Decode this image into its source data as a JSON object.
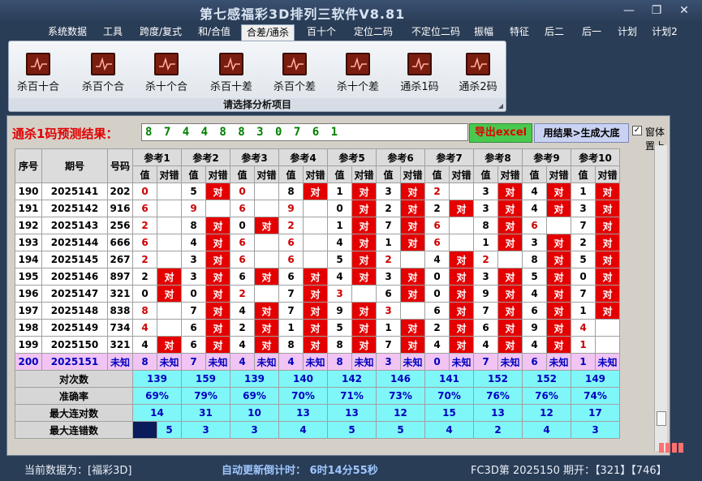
{
  "window": {
    "title": "第七感福彩3D排列三软件V8.81",
    "controls": {
      "minimize": "—",
      "restore": "❐",
      "close": "✕"
    }
  },
  "menu": [
    "系统数据",
    "工具",
    "跨度/复式",
    "和/合值",
    "合差/通杀",
    "百十个",
    "定位二码",
    "不定位二码",
    "振幅",
    "特征",
    "后二",
    "后一",
    "计划",
    "计划2"
  ],
  "menu_active": "合差/通杀",
  "ribbon": {
    "items": [
      "杀百十合",
      "杀百个合",
      "杀十个合",
      "杀百十差",
      "杀百个差",
      "杀十个差",
      "通杀1码",
      "通杀2码"
    ],
    "caption": "请选择分析项目",
    "icon": "chart-icon"
  },
  "prediction": {
    "label": "通杀1码预测结果：",
    "value": "8 7 4 4 8 8 3 0 7 6 1",
    "export_label": "导出excel",
    "generate_label": "用结果>生成大底",
    "pin_label": "窗体置上",
    "pin_checked": "✓"
  },
  "table": {
    "headers": {
      "seq": "序号",
      "period": "期号",
      "code": "号码",
      "refs": [
        "参考1",
        "参考2",
        "参考3",
        "参考4",
        "参考5",
        "参考6",
        "参考7",
        "参考8",
        "参考9",
        "参考10"
      ],
      "val": "值",
      "result": "对错"
    },
    "rows": [
      {
        "seq": "190",
        "period": "2025141",
        "code": "202",
        "cells": [
          [
            "0",
            "",
            "red"
          ],
          [
            "5",
            "对",
            ""
          ],
          [
            "0",
            "",
            "red"
          ],
          [
            "8",
            "对",
            ""
          ],
          [
            "1",
            "对",
            ""
          ],
          [
            "3",
            "对",
            ""
          ],
          [
            "2",
            "",
            "red"
          ],
          [
            "3",
            "对",
            ""
          ],
          [
            "4",
            "对",
            ""
          ],
          [
            "1",
            "对",
            ""
          ]
        ]
      },
      {
        "seq": "191",
        "period": "2025142",
        "code": "916",
        "cells": [
          [
            "6",
            "",
            "red"
          ],
          [
            "9",
            "",
            "red"
          ],
          [
            "6",
            "",
            "red"
          ],
          [
            "9",
            "",
            "red"
          ],
          [
            "0",
            "对",
            ""
          ],
          [
            "2",
            "对",
            ""
          ],
          [
            "2",
            "对",
            ""
          ],
          [
            "3",
            "对",
            ""
          ],
          [
            "4",
            "对",
            ""
          ],
          [
            "3",
            "对",
            ""
          ]
        ]
      },
      {
        "seq": "192",
        "period": "2025143",
        "code": "256",
        "cells": [
          [
            "2",
            "",
            "red"
          ],
          [
            "8",
            "对",
            ""
          ],
          [
            "0",
            "对",
            ""
          ],
          [
            "2",
            "",
            "red"
          ],
          [
            "1",
            "对",
            ""
          ],
          [
            "7",
            "对",
            ""
          ],
          [
            "6",
            "",
            "red"
          ],
          [
            "8",
            "对",
            ""
          ],
          [
            "6",
            "",
            "red"
          ],
          [
            "7",
            "对",
            ""
          ]
        ]
      },
      {
        "seq": "193",
        "period": "2025144",
        "code": "666",
        "cells": [
          [
            "6",
            "",
            "red"
          ],
          [
            "4",
            "对",
            ""
          ],
          [
            "6",
            "",
            "red"
          ],
          [
            "6",
            "",
            "red"
          ],
          [
            "4",
            "对",
            ""
          ],
          [
            "1",
            "对",
            ""
          ],
          [
            "6",
            "",
            "red"
          ],
          [
            "1",
            "对",
            ""
          ],
          [
            "3",
            "对",
            ""
          ],
          [
            "2",
            "对",
            ""
          ]
        ]
      },
      {
        "seq": "194",
        "period": "2025145",
        "code": "267",
        "cells": [
          [
            "2",
            "",
            "red"
          ],
          [
            "3",
            "对",
            ""
          ],
          [
            "6",
            "",
            "red"
          ],
          [
            "6",
            "",
            "red"
          ],
          [
            "5",
            "对",
            ""
          ],
          [
            "2",
            "",
            "red"
          ],
          [
            "4",
            "对",
            ""
          ],
          [
            "2",
            "",
            "red"
          ],
          [
            "8",
            "对",
            ""
          ],
          [
            "5",
            "对",
            ""
          ]
        ]
      },
      {
        "seq": "195",
        "period": "2025146",
        "code": "897",
        "cells": [
          [
            "2",
            "对",
            ""
          ],
          [
            "3",
            "对",
            ""
          ],
          [
            "6",
            "对",
            ""
          ],
          [
            "6",
            "对",
            ""
          ],
          [
            "4",
            "对",
            ""
          ],
          [
            "3",
            "对",
            ""
          ],
          [
            "0",
            "对",
            ""
          ],
          [
            "3",
            "对",
            ""
          ],
          [
            "5",
            "对",
            ""
          ],
          [
            "0",
            "对",
            ""
          ]
        ]
      },
      {
        "seq": "196",
        "period": "2025147",
        "code": "321",
        "cells": [
          [
            "0",
            "对",
            ""
          ],
          [
            "0",
            "对",
            ""
          ],
          [
            "2",
            "",
            "red"
          ],
          [
            "7",
            "对",
            ""
          ],
          [
            "3",
            "",
            "red"
          ],
          [
            "6",
            "对",
            ""
          ],
          [
            "0",
            "对",
            ""
          ],
          [
            "9",
            "对",
            ""
          ],
          [
            "4",
            "对",
            ""
          ],
          [
            "7",
            "对",
            ""
          ]
        ]
      },
      {
        "seq": "197",
        "period": "2025148",
        "code": "838",
        "cells": [
          [
            "8",
            "",
            "red"
          ],
          [
            "7",
            "对",
            ""
          ],
          [
            "4",
            "对",
            ""
          ],
          [
            "7",
            "对",
            ""
          ],
          [
            "9",
            "对",
            ""
          ],
          [
            "3",
            "",
            "red"
          ],
          [
            "6",
            "对",
            ""
          ],
          [
            "7",
            "对",
            ""
          ],
          [
            "6",
            "对",
            ""
          ],
          [
            "1",
            "对",
            ""
          ]
        ]
      },
      {
        "seq": "198",
        "period": "2025149",
        "code": "734",
        "cells": [
          [
            "4",
            "",
            "red"
          ],
          [
            "6",
            "对",
            ""
          ],
          [
            "2",
            "对",
            ""
          ],
          [
            "1",
            "对",
            ""
          ],
          [
            "5",
            "对",
            ""
          ],
          [
            "1",
            "对",
            ""
          ],
          [
            "2",
            "对",
            ""
          ],
          [
            "6",
            "对",
            ""
          ],
          [
            "9",
            "对",
            ""
          ],
          [
            "4",
            "",
            "red"
          ]
        ]
      },
      {
        "seq": "199",
        "period": "2025150",
        "code": "321",
        "cells": [
          [
            "4",
            "对",
            ""
          ],
          [
            "6",
            "对",
            ""
          ],
          [
            "4",
            "对",
            ""
          ],
          [
            "8",
            "对",
            ""
          ],
          [
            "8",
            "对",
            ""
          ],
          [
            "7",
            "对",
            ""
          ],
          [
            "4",
            "对",
            ""
          ],
          [
            "4",
            "对",
            ""
          ],
          [
            "4",
            "对",
            ""
          ],
          [
            "1",
            "",
            "red"
          ]
        ]
      }
    ],
    "unknown_row": {
      "seq": "200",
      "period": "2025151",
      "code": "未知",
      "values": [
        "8",
        "7",
        "4",
        "4",
        "8",
        "3",
        "0",
        "7",
        "6",
        "1"
      ],
      "unknown": "未知"
    },
    "stats": [
      {
        "label": "对次数",
        "values": [
          "139",
          "159",
          "139",
          "140",
          "142",
          "146",
          "141",
          "152",
          "152",
          "149"
        ]
      },
      {
        "label": "准确率",
        "values": [
          "69%",
          "79%",
          "69%",
          "70%",
          "71%",
          "73%",
          "70%",
          "76%",
          "76%",
          "74%"
        ]
      },
      {
        "label": "最大连对数",
        "values": [
          "14",
          "31",
          "10",
          "13",
          "13",
          "12",
          "15",
          "13",
          "12",
          "17"
        ]
      },
      {
        "label": "最大连错数",
        "values": [
          "5",
          "3",
          "3",
          "4",
          "5",
          "5",
          "4",
          "2",
          "4",
          "3"
        ]
      }
    ]
  },
  "status": {
    "current_data": "当前数据为：[福彩3D]",
    "countdown": "自动更新倒计时： 6时14分55秒",
    "latest": "FC3D第 2025150 期开：【321】【746】"
  }
}
